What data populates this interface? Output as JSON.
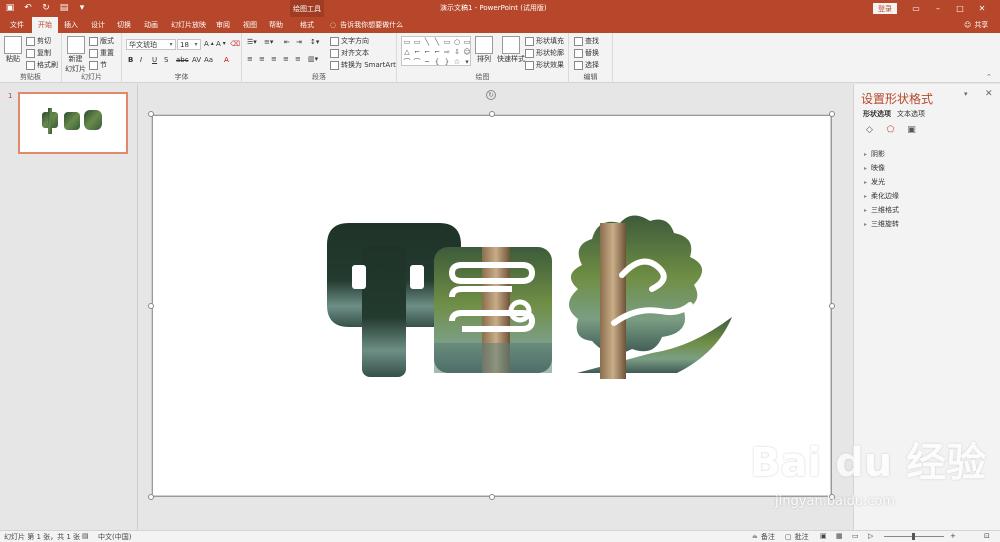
{
  "titlebar": {
    "contextual_tab_group": "绘图工具",
    "document_title": "演示文稿1  -  PowerPoint (试用版)",
    "login_label": "登录"
  },
  "tabs": [
    {
      "label": "文件"
    },
    {
      "label": "开始"
    },
    {
      "label": "插入"
    },
    {
      "label": "设计"
    },
    {
      "label": "切换"
    },
    {
      "label": "动画"
    },
    {
      "label": "幻灯片放映"
    },
    {
      "label": "审阅"
    },
    {
      "label": "视图"
    },
    {
      "label": "帮助"
    },
    {
      "label": "格式"
    }
  ],
  "active_tab": "开始",
  "tell_me": "告诉我你想要做什么",
  "share_label": "共享",
  "ribbon": {
    "clipboard": {
      "paste": "粘贴",
      "cut": "剪切",
      "copy": "复制",
      "format_painter": "格式刷",
      "label": "剪贴板"
    },
    "slides": {
      "new_slide": "新建\n幻灯片",
      "layout": "版式",
      "reset": "重置",
      "section": "节",
      "label": "幻灯片"
    },
    "font": {
      "font_name": "华文琥珀",
      "font_size": "18",
      "label": "字体"
    },
    "paragraph": {
      "text_direction": "文字方向",
      "align_text": "对齐文本",
      "smartart": "转换为 SmartArt",
      "label": "段落"
    },
    "drawing": {
      "arrange": "排列",
      "quick_styles": "快速样式",
      "shape_fill": "形状填充",
      "shape_outline": "形状轮廓",
      "shape_effects": "形状效果",
      "label": "绘图"
    },
    "editing": {
      "find": "查找",
      "replace": "替换",
      "select": "选择",
      "label": "编辑"
    }
  },
  "thumbnail": {
    "number": "1"
  },
  "slide": {
    "text": "中国梦"
  },
  "format_pane": {
    "title": "设置形状格式",
    "tabs": [
      "形状选项",
      "文本选项"
    ],
    "options": [
      "阴影",
      "映像",
      "发光",
      "柔化边缘",
      "三维格式",
      "三维旋转"
    ]
  },
  "statusbar": {
    "slide_info": "幻灯片 第 1 张，共 1 张",
    "language": "中文(中国)",
    "notes": "备注",
    "comments": "批注"
  },
  "watermark": {
    "text": "Bai du 经验",
    "url": "jingyan.baidu.com"
  },
  "colors": {
    "accent": "#b7472a",
    "ribbon_bg": "#f3f3f3",
    "canvas_bg": "#e6e6e6"
  }
}
